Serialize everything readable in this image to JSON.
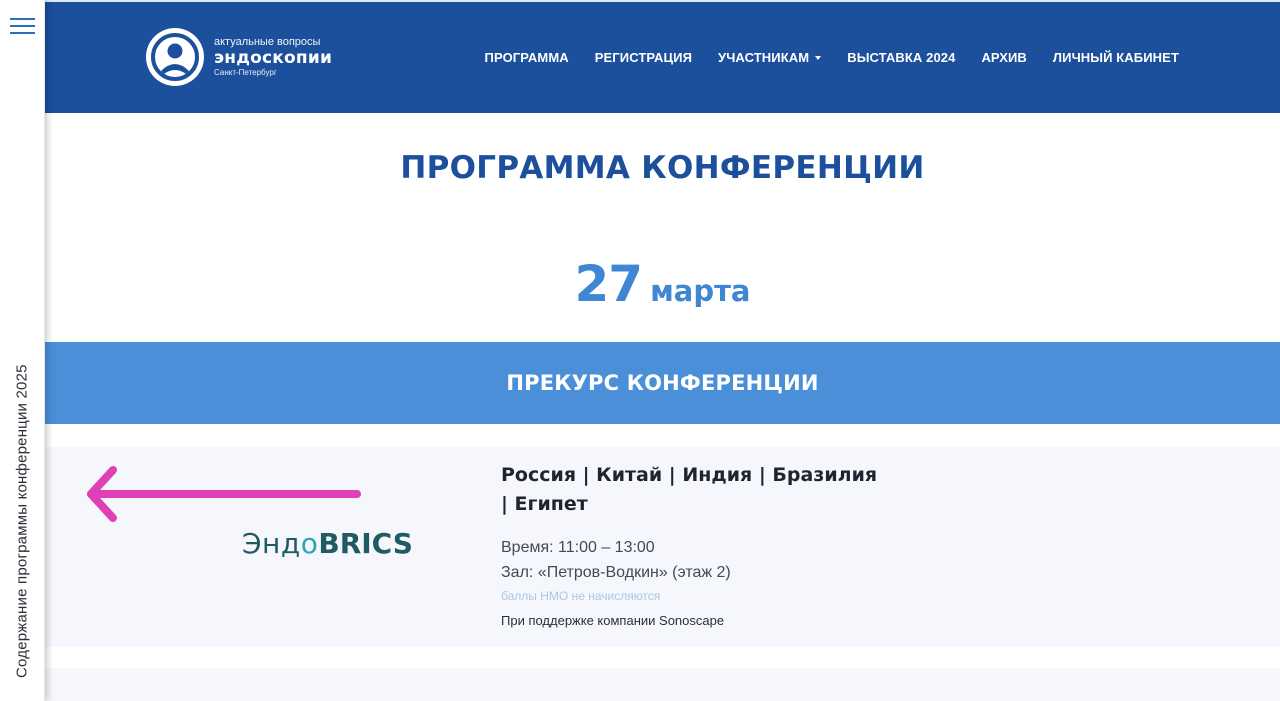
{
  "sidebar": {
    "menu_icon": "hamburger-menu-icon",
    "vertical_label": "Содержание программы конференции 2025"
  },
  "header": {
    "logo": {
      "icon": "person-logo-icon",
      "top_text": "актуальные вопросы",
      "main_text": "эндоскопии",
      "city_text": "Санкт-Петербург"
    },
    "nav": [
      {
        "label": "ПРОГРАММА"
      },
      {
        "label": "РЕГИСТРАЦИЯ"
      },
      {
        "label": "УЧАСТНИКАМ",
        "has_dropdown": true
      },
      {
        "label": "ВЫСТАВКА 2024"
      },
      {
        "label": "АРХИВ"
      },
      {
        "label": "ЛИЧНЫЙ КАБИНЕТ"
      }
    ]
  },
  "main": {
    "title": "ПРОГРАММА КОНФЕРЕНЦИИ",
    "date": {
      "day": "27",
      "month": "марта"
    },
    "section_title": "ПРЕКУРС КОНФЕРЕНЦИИ",
    "session": {
      "logo": {
        "endo": "Эндо",
        "o": "о",
        "brics": "BRICS"
      },
      "annotation_icon": "left-arrow-icon",
      "title": "Россия | Китай | Индия | Бразилия | Египет",
      "time": "Время: 11:00 – 13:00",
      "room": "Зал: «Петров-Водкин» (этаж 2)",
      "nmo_note": "баллы НМО не начисляются",
      "sponsor": "При поддержке компании Sonoscape"
    }
  },
  "colors": {
    "header_bg": "#1c4f9c",
    "band_bg": "#4a8fd8",
    "title": "#1c4f9c",
    "date": "#3f86d3",
    "arrow": "#e040b5",
    "brics_teal": "#1e5b63"
  }
}
